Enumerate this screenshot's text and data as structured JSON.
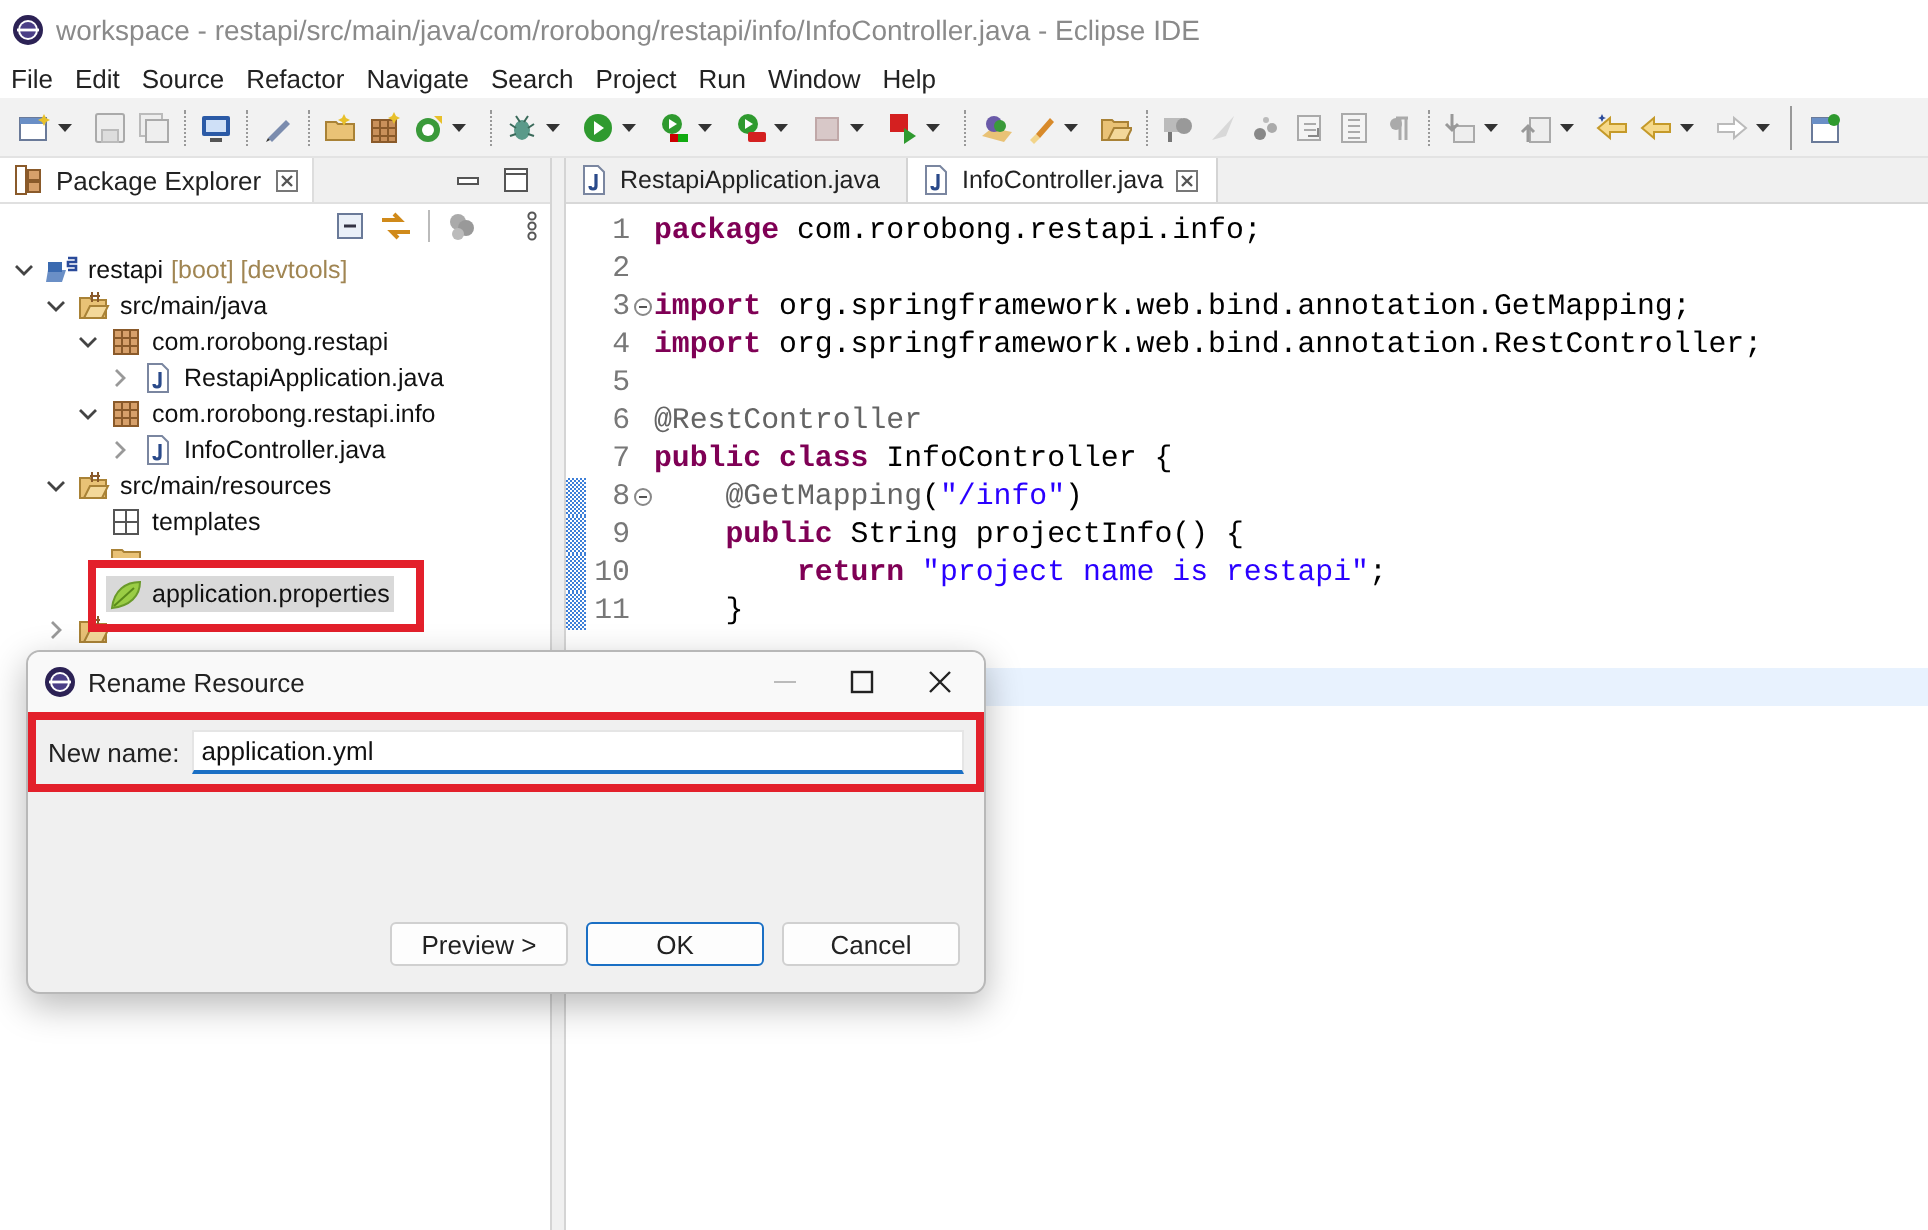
{
  "window": {
    "title": "workspace - restapi/src/main/java/com/rorobong/restapi/info/InfoController.java - Eclipse IDE"
  },
  "menu": [
    "File",
    "Edit",
    "Source",
    "Refactor",
    "Navigate",
    "Search",
    "Project",
    "Run",
    "Window",
    "Help"
  ],
  "explorer": {
    "title": "Package Explorer",
    "tree": [
      {
        "label": "restapi",
        "decoration": "[boot] [devtools]",
        "kind": "project",
        "expandable": true,
        "expanded": true,
        "selected": false,
        "highlighted": false,
        "children": [
          {
            "label": "src/main/java",
            "kind": "source-folder",
            "expandable": true,
            "expanded": true,
            "selected": false,
            "highlighted": false,
            "children": [
              {
                "label": "com.rorobong.restapi",
                "kind": "package",
                "expandable": true,
                "expanded": true,
                "selected": false,
                "highlighted": false,
                "children": [
                  {
                    "label": "RestapiApplication.java",
                    "kind": "java-file",
                    "expandable": true,
                    "expanded": false,
                    "selected": false,
                    "highlighted": false
                  }
                ]
              },
              {
                "label": "com.rorobong.restapi.info",
                "kind": "package",
                "expandable": true,
                "expanded": true,
                "selected": false,
                "highlighted": false,
                "children": [
                  {
                    "label": "InfoController.java",
                    "kind": "java-file",
                    "expandable": true,
                    "expanded": false,
                    "selected": false,
                    "highlighted": false
                  }
                ]
              }
            ]
          },
          {
            "label": "src/main/resources",
            "kind": "source-folder",
            "expandable": true,
            "expanded": true,
            "selected": false,
            "highlighted": false,
            "children": [
              {
                "label": "templates",
                "kind": "empty-package",
                "expandable": false,
                "selected": false,
                "highlighted": false
              },
              {
                "kind": "folder",
                "expandable": false,
                "selected": false,
                "highlighted": false
              },
              {
                "label": "application.properties",
                "kind": "properties",
                "expandable": false,
                "selected": true,
                "highlighted": true
              }
            ]
          },
          {
            "kind": "source-folder",
            "expandable": true,
            "expanded": false,
            "selected": false,
            "highlighted": false
          }
        ]
      }
    ]
  },
  "editor": {
    "tabs": [
      {
        "label": "RestapiApplication.java",
        "selected": false
      },
      {
        "label": "InfoController.java",
        "selected": true
      }
    ],
    "lines": [
      {
        "number": "1",
        "foldable": false,
        "changed": false,
        "current": false,
        "tokens": [
          {
            "kind": "keyword",
            "text": "package"
          },
          {
            "kind": "plain",
            "text": " com.rorobong.restapi.info;"
          }
        ]
      },
      {
        "number": "2",
        "foldable": false,
        "changed": false,
        "current": false
      },
      {
        "number": "3",
        "foldable": true,
        "changed": false,
        "current": false,
        "tokens": [
          {
            "kind": "keyword",
            "text": "import"
          },
          {
            "kind": "plain",
            "text": " org.springframework.web.bind.annotation.GetMapping;"
          }
        ]
      },
      {
        "number": "4",
        "foldable": false,
        "changed": false,
        "current": false,
        "tokens": [
          {
            "kind": "keyword",
            "text": "import"
          },
          {
            "kind": "plain",
            "text": " org.springframework.web.bind.annotation.RestController;"
          }
        ]
      },
      {
        "number": "5",
        "foldable": false,
        "changed": false,
        "current": false
      },
      {
        "number": "6",
        "foldable": false,
        "changed": false,
        "current": false,
        "tokens": [
          {
            "kind": "annotation",
            "text": "@RestController"
          }
        ]
      },
      {
        "number": "7",
        "foldable": false,
        "changed": false,
        "current": false,
        "tokens": [
          {
            "kind": "keyword",
            "text": "public class"
          },
          {
            "kind": "plain",
            "text": " InfoController {"
          }
        ]
      },
      {
        "number": "8",
        "foldable": true,
        "changed": true,
        "current": false,
        "tokens": [
          {
            "kind": "annotation",
            "text": "    @GetMapping"
          },
          {
            "kind": "plain",
            "text": "("
          },
          {
            "kind": "string",
            "text": "\"/info\""
          },
          {
            "kind": "plain",
            "text": ")"
          }
        ]
      },
      {
        "number": "9",
        "foldable": false,
        "changed": true,
        "current": false,
        "tokens": [
          {
            "kind": "keyword",
            "text": "    public"
          },
          {
            "kind": "plain",
            "text": " String projectInfo() {"
          }
        ]
      },
      {
        "number": "10",
        "foldable": false,
        "changed": true,
        "current": false,
        "tokens": [
          {
            "kind": "keyword",
            "text": "        return"
          },
          {
            "kind": "string",
            "text": " \"project name is restapi\""
          },
          {
            "kind": "plain",
            "text": ";"
          }
        ]
      },
      {
        "number": "11",
        "foldable": false,
        "changed": true,
        "current": false,
        "tokens": [
          {
            "kind": "plain",
            "text": "    }"
          }
        ]
      },
      {
        "foldable": false,
        "changed": false,
        "current": false
      },
      {
        "foldable": false,
        "changed": false,
        "current": true
      }
    ]
  },
  "dialog": {
    "title": "Rename Resource",
    "label": "New name:",
    "value": "application.yml",
    "highlighted": true,
    "buttons": [
      {
        "label": "Preview >",
        "default": false
      },
      {
        "label": "OK",
        "default": true
      },
      {
        "label": "Cancel",
        "default": false
      }
    ]
  }
}
